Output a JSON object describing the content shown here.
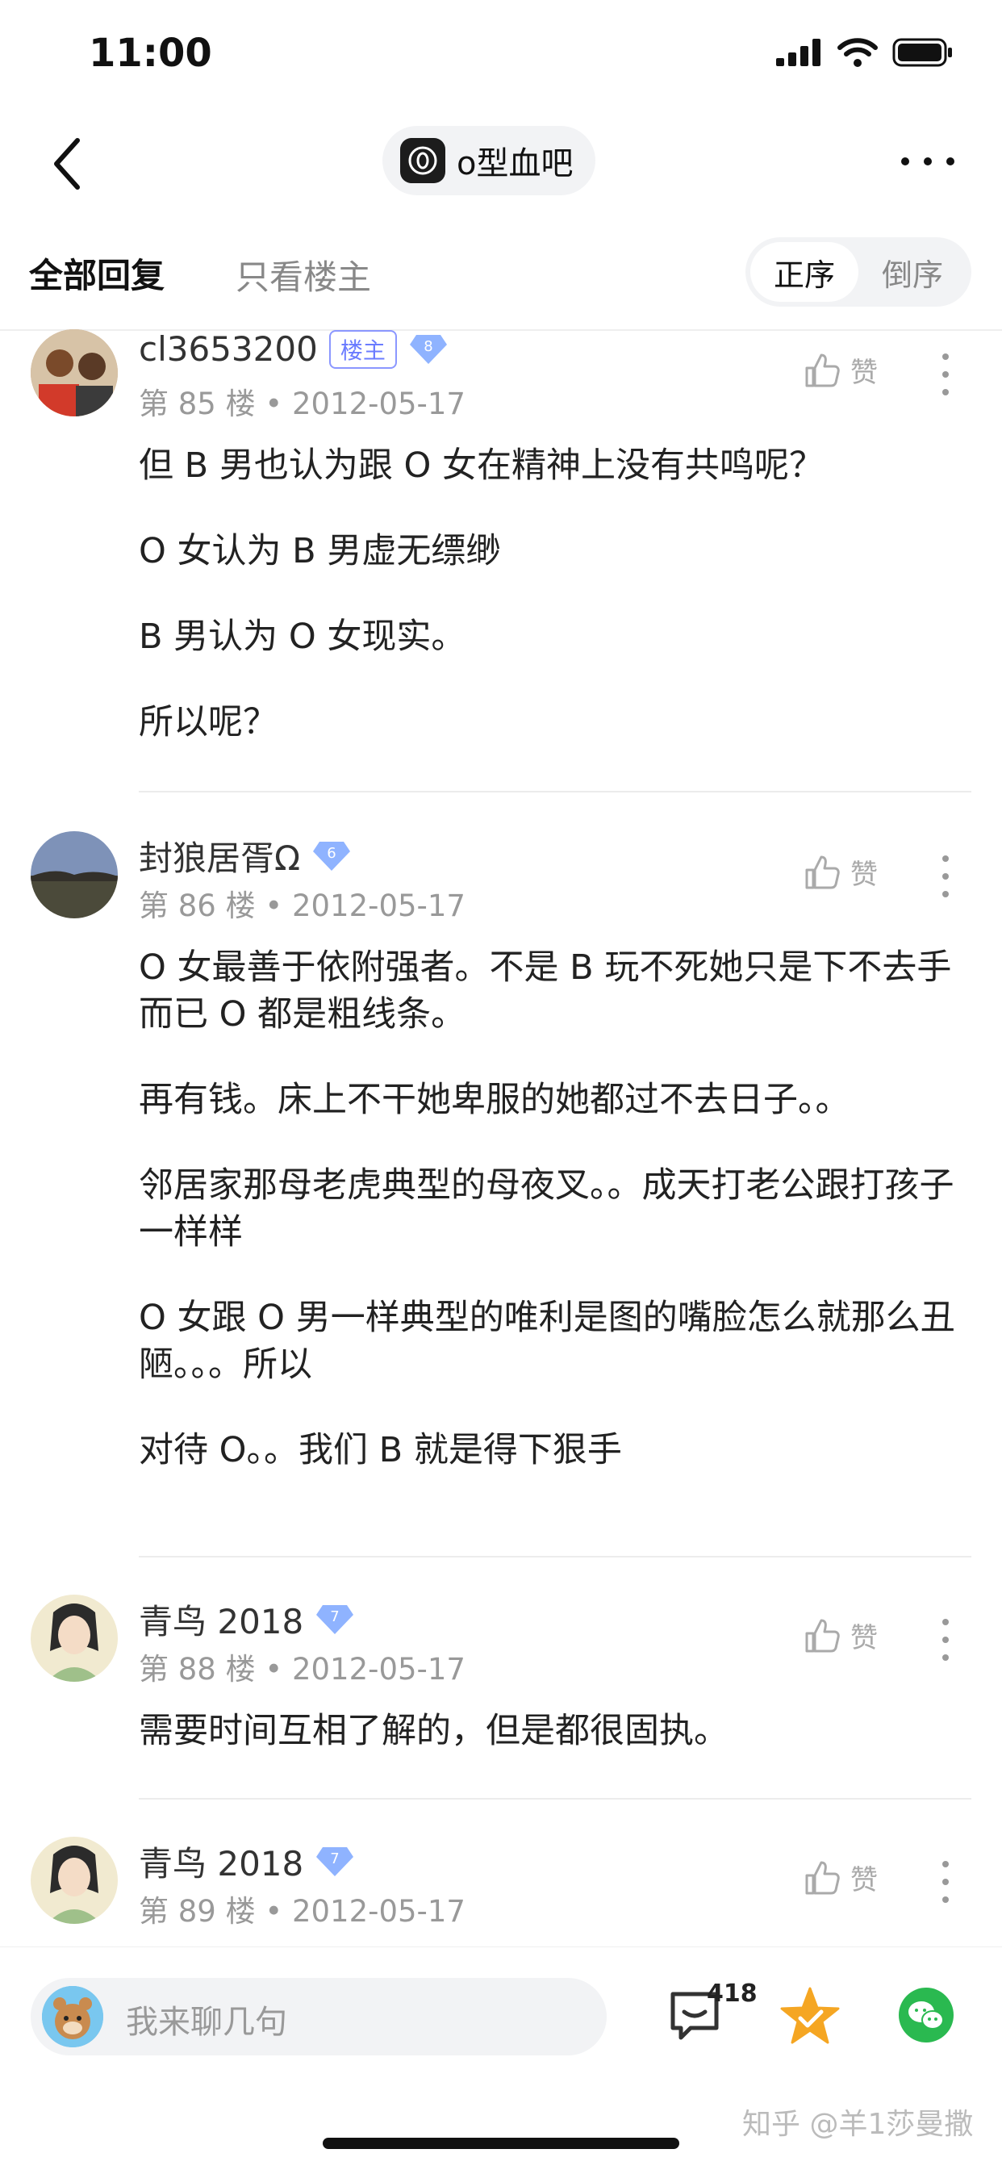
{
  "status": {
    "time": "11:00"
  },
  "nav": {
    "forum_name": "o型血吧"
  },
  "tabs": {
    "all": "全部回复",
    "host_only": "只看楼主",
    "sort_asc": "正序",
    "sort_desc": "倒序"
  },
  "posts": [
    {
      "username": "cl3653200",
      "host_label": "楼主",
      "level": "8",
      "meta": "第 85 楼 • 2012-05-17",
      "like_label": "赞",
      "paragraphs": [
        "但 B 男也认为跟 O 女在精神上没有共鸣呢？",
        "O 女认为 B 男虚无缥缈",
        "B 男认为 O 女现实。",
        "所以呢？"
      ]
    },
    {
      "username": "封狼居胥Ω",
      "level": "6",
      "meta": "第 86 楼 • 2012-05-17",
      "like_label": "赞",
      "paragraphs": [
        "O 女最善于依附强者。不是 B 玩不死她只是下不去手而已 O 都是粗线条。",
        "再有钱。床上不干她卑服的她都过不去日子。。",
        "邻居家那母老虎典型的母夜叉。。成天打老公跟打孩子一样样",
        "O 女跟 O 男一样典型的唯利是图的嘴脸怎么就那么丑陋。。。所以",
        "对待 O。。我们 B 就是得下狠手"
      ]
    },
    {
      "username": "青鸟 2018",
      "level": "7",
      "meta": "第 88 楼 • 2012-05-17",
      "like_label": "赞",
      "paragraphs": [
        "需要时间互相了解的，但是都很固执。"
      ]
    },
    {
      "username": "青鸟 2018",
      "level": "7",
      "meta": "第 89 楼 • 2012-05-17",
      "like_label": "赞",
      "paragraphs": []
    }
  ],
  "bottom": {
    "input_placeholder": "我来聊几句",
    "reply_count": "418",
    "watermark": "知乎 @羊1莎曼撒"
  },
  "colors": {
    "accent_blue": "#6b7cff",
    "star": "#f5a623",
    "wechat": "#2ab950"
  }
}
